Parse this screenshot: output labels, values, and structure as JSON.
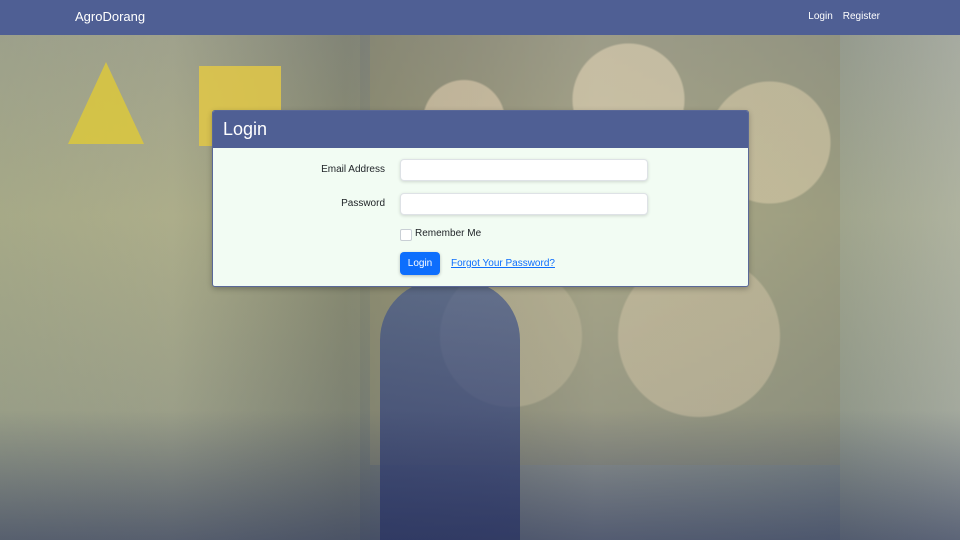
{
  "navbar": {
    "brand": "AgroDorang",
    "links": [
      {
        "label": "Login"
      },
      {
        "label": "Register"
      }
    ]
  },
  "login_card": {
    "title": "Login",
    "email": {
      "label": "Email Address",
      "value": "",
      "placeholder": ""
    },
    "password": {
      "label": "Password",
      "value": "",
      "placeholder": ""
    },
    "remember_me": {
      "label": "Remember Me",
      "checked": false
    },
    "submit_label": "Login",
    "forgot_label": "Forgot Your Password?"
  },
  "colors": {
    "navbar_bg": "#4f5f94",
    "card_header_bg": "#4f5f94",
    "card_body_bg": "#f2fcf3",
    "primary": "#0d6efd"
  },
  "icons": {
    "background": "cargo-truck-photo"
  }
}
